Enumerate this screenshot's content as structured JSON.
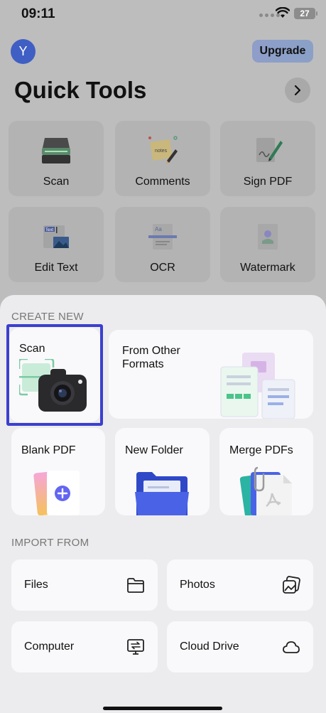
{
  "status": {
    "time": "09:11",
    "battery": "27"
  },
  "header": {
    "avatar_letter": "Y",
    "upgrade_label": "Upgrade",
    "title": "Quick Tools"
  },
  "quick_tools": [
    {
      "label": "Scan",
      "icon": "scanner-icon"
    },
    {
      "label": "Comments",
      "icon": "sticky-note-icon"
    },
    {
      "label": "Sign PDF",
      "icon": "signature-icon"
    },
    {
      "label": "Edit Text",
      "icon": "edit-text-icon"
    },
    {
      "label": "OCR",
      "icon": "ocr-icon"
    },
    {
      "label": "Watermark",
      "icon": "watermark-icon"
    }
  ],
  "create_new": {
    "heading": "CREATE NEW",
    "scan": "Scan",
    "other_formats_line1": "From Other",
    "other_formats_line2": "Formats",
    "blank_pdf": "Blank PDF",
    "new_folder": "New Folder",
    "merge_pdfs": "Merge PDFs"
  },
  "import_from": {
    "heading": "IMPORT FROM",
    "items": [
      {
        "label": "Files",
        "icon": "folder-icon"
      },
      {
        "label": "Photos",
        "icon": "photos-icon"
      },
      {
        "label": "Computer",
        "icon": "computer-transfer-icon"
      },
      {
        "label": "Cloud Drive",
        "icon": "cloud-icon"
      }
    ]
  },
  "colors": {
    "overlay": "#bdbdbd",
    "sheet": "#ececee",
    "card": "#f9f9fb",
    "highlight": "#3b3fd0",
    "avatar": "#3f5fc4"
  }
}
